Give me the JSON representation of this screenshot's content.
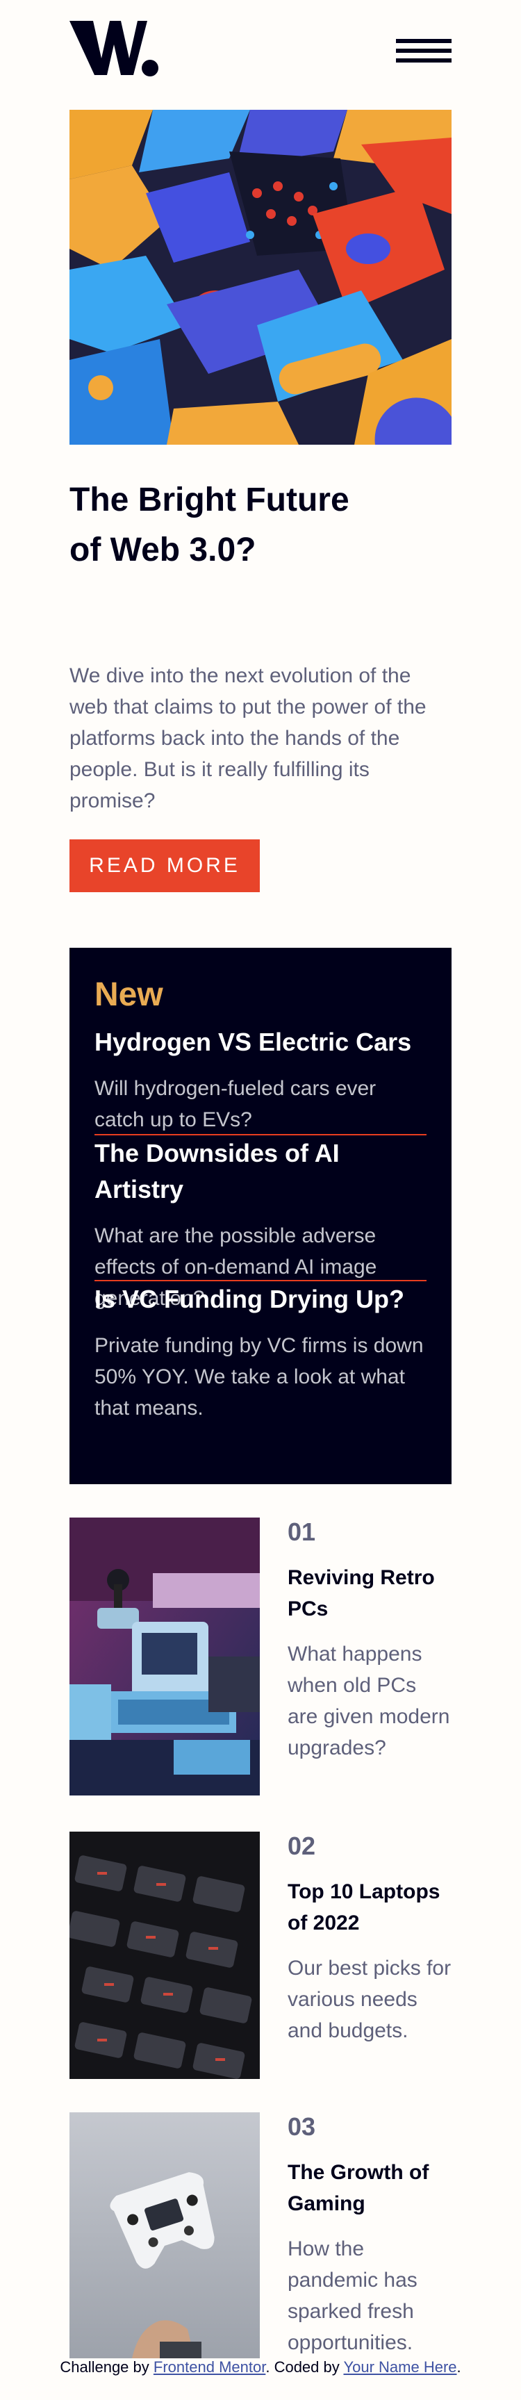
{
  "header": {
    "logo_text": "W.",
    "menu_label": "menu"
  },
  "hero": {
    "title": "The Bright Future of Web 3.0?",
    "description": "We dive into the next evolution of the web that claims to put the power of the platforms back into the hands of the people. But is it really fulfilling its promise?",
    "button": "READ MORE"
  },
  "new_section": {
    "heading": "New",
    "items": [
      {
        "title": "Hydrogen VS Electric Cars",
        "desc": "Will hydrogen-fueled cars ever catch up to EVs?"
      },
      {
        "title": "The Downsides of AI Artistry",
        "desc": "What are the possible adverse effects of on-demand AI image generation?"
      },
      {
        "title": "Is VC Funding Drying Up?",
        "desc": "Private funding by VC firms is down 50% YOY. We take a look at what that means."
      }
    ]
  },
  "list": [
    {
      "number": "01",
      "title": "Reviving Retro PCs",
      "desc": "What happens when old PCs are given modern upgrades?"
    },
    {
      "number": "02",
      "title": "Top 10 Laptops of 2022",
      "desc": "Our best picks for various needs and budgets."
    },
    {
      "number": "03",
      "title": "The Growth of Gaming",
      "desc": "How the pandemic has sparked fresh opportunities."
    }
  ],
  "attribution": {
    "prefix": "Challenge by",
    "link1": "Frontend Mentor",
    "middle": ". Coded by",
    "link2": "Your Name Here",
    "suffix": "."
  },
  "colors": {
    "accent": "#e8442a",
    "gold": "#e9ab53",
    "dark": "#00001a",
    "muted": "#5e607a"
  }
}
